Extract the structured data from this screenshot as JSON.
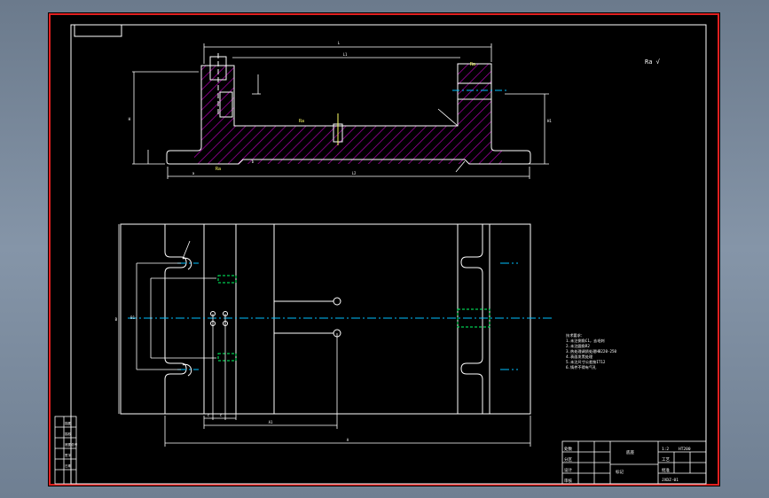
{
  "colors": {
    "background": "#000000",
    "outer_frame": "#e02020",
    "line": "#ffffff",
    "hatch": "#b000b0",
    "center_line": "#00bfff",
    "hidden_line": "#00ff66",
    "dimension": "#ffffff",
    "annotation": "#ffff66"
  },
  "drawing": {
    "top_dims": {
      "overall_length": "L",
      "inner_length": "L1",
      "height": "H",
      "bottom_length": "L2",
      "base_offset": "a",
      "tab": "b",
      "right_height": "H1"
    },
    "roughness_mark": "Ra √",
    "roughness_labels": [
      "Ra",
      "Ra",
      "Ra"
    ],
    "plan_dims": {
      "width": "B",
      "inner_width": "B1",
      "overall_length": "A",
      "offset": "A1",
      "hole_spacing": [
        "c",
        "c"
      ]
    },
    "tech_requirements": [
      "技术要求：",
      "1.未注倒角C1，去毛刺",
      "2.未注圆角R2",
      "3.热处理调质处理HB220-250",
      "4.表面发黑处理",
      "5.未注尺寸公差按IT12",
      "6.铸件不得有气孔"
    ],
    "title_block": {
      "part_name": "底座",
      "scale": "1:2",
      "material": "HT200",
      "drawing_no": "JXDZ-01",
      "labels": [
        "标记",
        "处数",
        "分区",
        "设计",
        "审核",
        "工艺",
        "批准"
      ]
    },
    "left_strip": [
      "描图",
      "描校",
      "底图总号",
      "签字",
      "日期"
    ]
  }
}
